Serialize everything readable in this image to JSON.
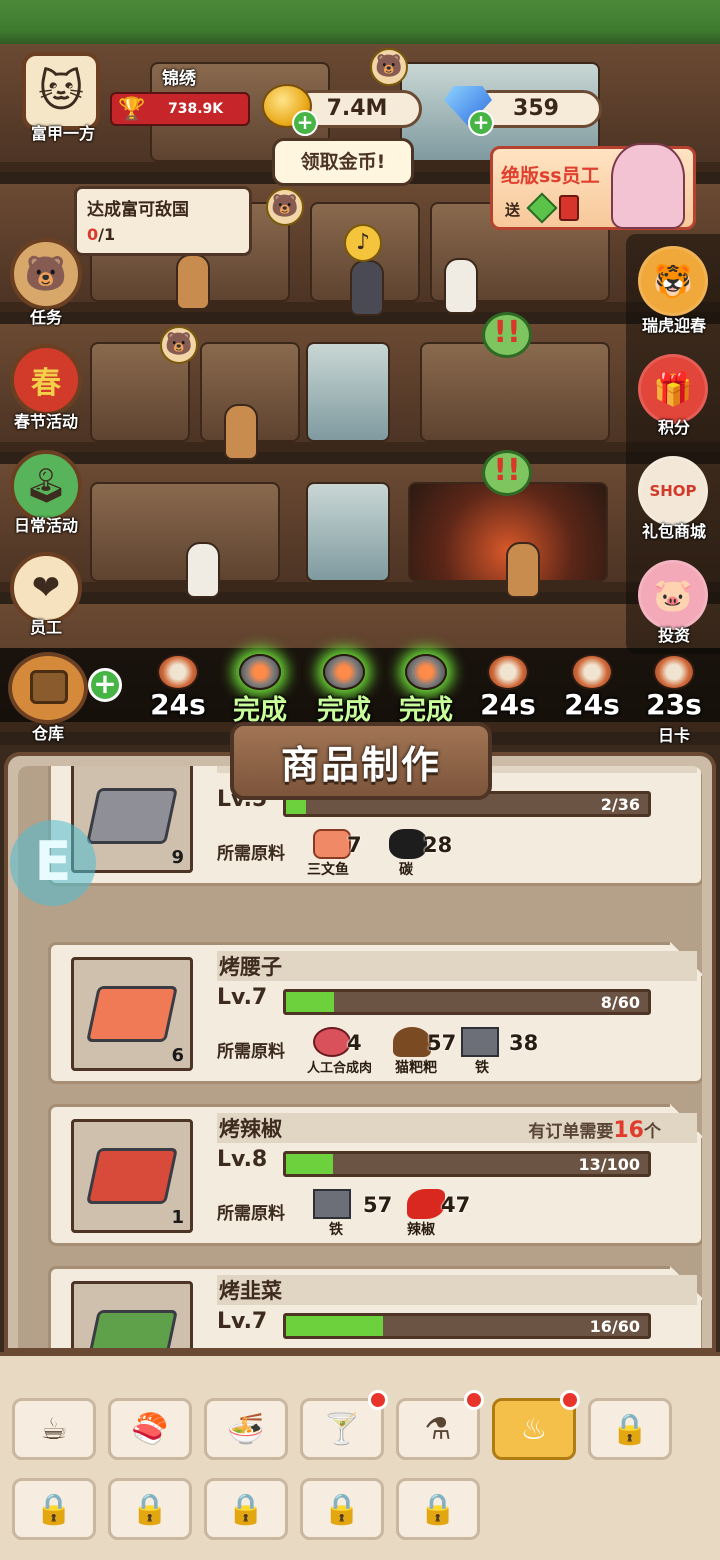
{
  "player": {
    "avatar_icon": "cat-avatar-icon",
    "title": "富甲一方",
    "name": "锦绣",
    "trophy_value": "738.9K"
  },
  "currency": {
    "coins": "7.4M",
    "gems": "359",
    "claim_coins_label": "领取金币!"
  },
  "promo": {
    "title": "绝版ss员工",
    "send_label": "送"
  },
  "quest": {
    "title": "达成富可敌国",
    "progress_current": "0",
    "progress_total": "/1"
  },
  "left_menu": [
    {
      "label": "任务",
      "icon": "bear-mascot-icon"
    },
    {
      "label": "春节活动",
      "icon": "spring-festival-icon",
      "glyph": "春"
    },
    {
      "label": "日常活动",
      "icon": "arcade-machine-icon"
    },
    {
      "label": "员工",
      "icon": "staff-heart-icon"
    }
  ],
  "right_menu": [
    {
      "label": "瑞虎迎春",
      "icon": "tiger-icon"
    },
    {
      "label": "积分",
      "icon": "gift-box-icon"
    },
    {
      "label": "礼包商城",
      "icon": "shop-icon",
      "glyph": "SHOP"
    },
    {
      "label": "投资",
      "icon": "piggy-bank-icon"
    },
    {
      "label": "日卡",
      "icon": "day-card-icon"
    }
  ],
  "warehouse": {
    "label": "仓库"
  },
  "queue": [
    {
      "label": "24s",
      "done": false
    },
    {
      "label": "完成",
      "done": true
    },
    {
      "label": "完成",
      "done": true
    },
    {
      "label": "完成",
      "done": true
    },
    {
      "label": "24s",
      "done": false
    },
    {
      "label": "24s",
      "done": false
    },
    {
      "label": "23s",
      "done": false
    }
  ],
  "panel": {
    "title": "商品制作",
    "materials_label": "所需原料"
  },
  "recipes": [
    {
      "name": "",
      "level": "Lv.5",
      "progress_text": "2/36",
      "progress_fraction": 0.056,
      "count": "9",
      "order_note": "",
      "order_count": "",
      "materials": [
        {
          "name": "三文鱼",
          "qty": "7",
          "icon": "salmon-icon"
        },
        {
          "name": "碳",
          "qty": "28",
          "icon": "charcoal-icon"
        }
      ]
    },
    {
      "name": "烤腰子",
      "level": "Lv.7",
      "progress_text": "8/60",
      "progress_fraction": 0.133,
      "count": "6",
      "order_note": "",
      "order_count": "",
      "materials": [
        {
          "name": "人工合成肉",
          "qty": "4",
          "icon": "synthetic-meat-icon"
        },
        {
          "name": "猫粑粑",
          "qty": "57",
          "icon": "poop-icon"
        },
        {
          "name": "铁",
          "qty": "38",
          "icon": "iron-ingot-icon"
        }
      ]
    },
    {
      "name": "烤辣椒",
      "level": "Lv.8",
      "progress_text": "13/100",
      "progress_fraction": 0.13,
      "count": "1",
      "order_note": "有订单需要",
      "order_count": "16",
      "order_unit": "个",
      "materials": [
        {
          "name": "铁",
          "qty": "57",
          "icon": "iron-ingot-icon"
        },
        {
          "name": "辣椒",
          "qty": "47",
          "icon": "chili-icon"
        }
      ]
    },
    {
      "name": "烤韭菜",
      "level": "Lv.7",
      "progress_text": "16/60",
      "progress_fraction": 0.267,
      "count": "",
      "order_note": "",
      "order_count": "",
      "materials": []
    }
  ],
  "categories": [
    {
      "icon": "coffee-cup-icon",
      "state": "normal",
      "dot": false
    },
    {
      "icon": "sushi-icon",
      "state": "normal",
      "dot": false
    },
    {
      "icon": "noodle-bowl-icon",
      "state": "normal",
      "dot": false
    },
    {
      "icon": "cocktail-icon",
      "state": "normal",
      "dot": true
    },
    {
      "icon": "flask-icon",
      "state": "normal",
      "dot": true
    },
    {
      "icon": "grill-icon",
      "state": "active",
      "dot": true
    },
    {
      "icon": "lock-icon",
      "state": "locked",
      "dot": false
    },
    {
      "icon": "lock-icon",
      "state": "locked",
      "dot": false
    },
    {
      "icon": "lock-icon",
      "state": "locked",
      "dot": false
    },
    {
      "icon": "lock-icon",
      "state": "locked",
      "dot": false
    },
    {
      "icon": "lock-icon",
      "state": "locked",
      "dot": false
    },
    {
      "icon": "lock-icon",
      "state": "locked",
      "dot": false
    }
  ],
  "colors": {
    "progress_fill": "#6dd13d",
    "done_glow": "#71e53b",
    "order_highlight": "#e03b2c",
    "active_tab": "#f4c04a"
  }
}
